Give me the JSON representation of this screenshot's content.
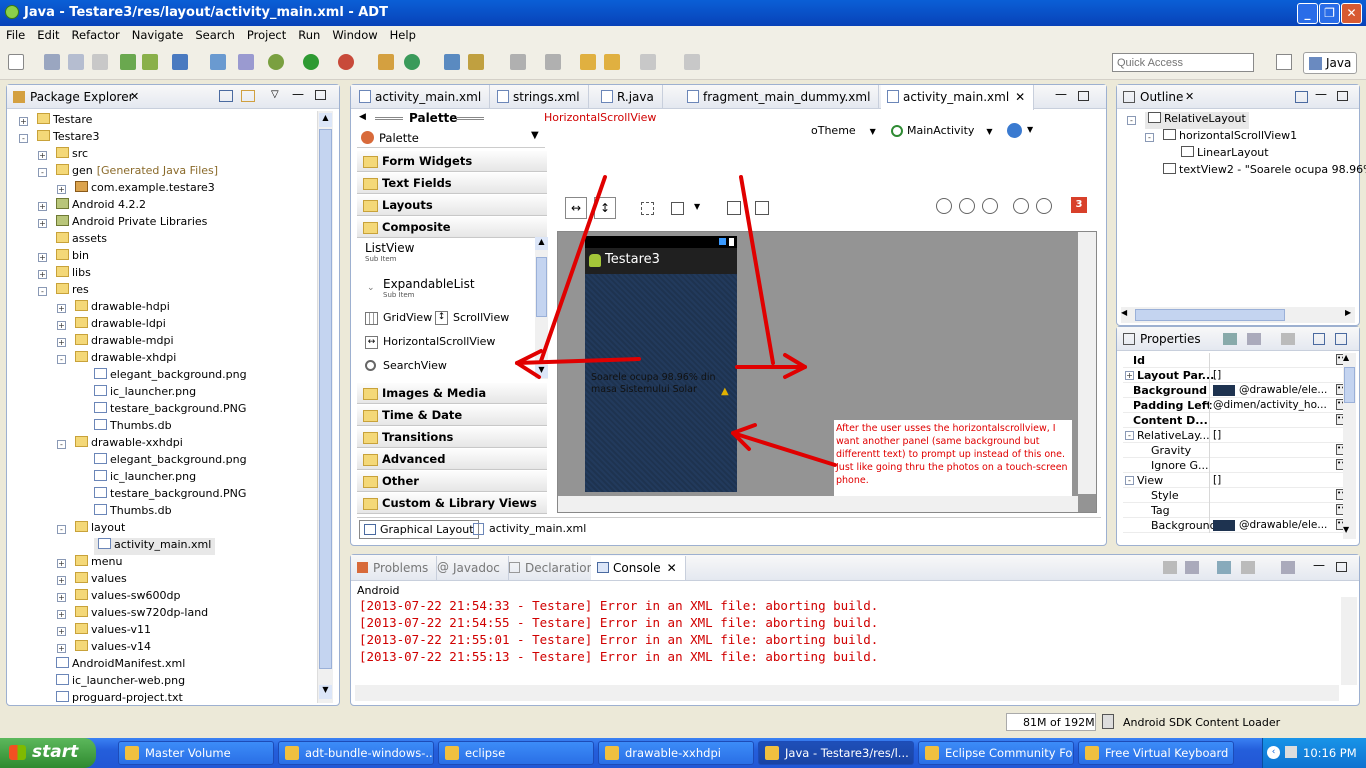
{
  "window": {
    "title": "Java - Testare3/res/layout/activity_main.xml - ADT"
  },
  "menu": [
    "File",
    "Edit",
    "Refactor",
    "Navigate",
    "Search",
    "Project",
    "Run",
    "Window",
    "Help"
  ],
  "quick_access": {
    "placeholder": "Quick Access"
  },
  "perspective": {
    "label": "Java"
  },
  "package_explorer": {
    "title": "Package Explorer",
    "items": [
      {
        "label": "Testare",
        "level": 0,
        "icon": "project",
        "toggle": "+"
      },
      {
        "label": "Testare3",
        "level": 0,
        "icon": "project",
        "toggle": "-"
      },
      {
        "label": "src",
        "level": 1,
        "icon": "folder",
        "toggle": "+"
      },
      {
        "label": "gen",
        "extra": "[Generated Java Files]",
        "level": 1,
        "icon": "folder",
        "toggle": "-"
      },
      {
        "label": "com.example.testare3",
        "level": 2,
        "icon": "package",
        "toggle": "+"
      },
      {
        "label": "Android 4.2.2",
        "level": 1,
        "icon": "library",
        "toggle": "+"
      },
      {
        "label": "Android Private Libraries",
        "level": 1,
        "icon": "library",
        "toggle": "+"
      },
      {
        "label": "assets",
        "level": 1,
        "icon": "folder",
        "toggle": ""
      },
      {
        "label": "bin",
        "level": 1,
        "icon": "folder",
        "toggle": "+"
      },
      {
        "label": "libs",
        "level": 1,
        "icon": "folder",
        "toggle": "+"
      },
      {
        "label": "res",
        "level": 1,
        "icon": "folder",
        "toggle": "-"
      },
      {
        "label": "drawable-hdpi",
        "level": 2,
        "icon": "folder",
        "toggle": "+"
      },
      {
        "label": "drawable-ldpi",
        "level": 2,
        "icon": "folder",
        "toggle": "+"
      },
      {
        "label": "drawable-mdpi",
        "level": 2,
        "icon": "folder",
        "toggle": "+"
      },
      {
        "label": "drawable-xhdpi",
        "level": 2,
        "icon": "folder",
        "toggle": "-"
      },
      {
        "label": "elegant_background.png",
        "level": 3,
        "icon": "file",
        "toggle": ""
      },
      {
        "label": "ic_launcher.png",
        "level": 3,
        "icon": "file",
        "toggle": ""
      },
      {
        "label": "testare_background.PNG",
        "level": 3,
        "icon": "file",
        "toggle": ""
      },
      {
        "label": "Thumbs.db",
        "level": 3,
        "icon": "file",
        "toggle": ""
      },
      {
        "label": "drawable-xxhdpi",
        "level": 2,
        "icon": "folder",
        "toggle": "-"
      },
      {
        "label": "elegant_background.png",
        "level": 3,
        "icon": "file",
        "toggle": ""
      },
      {
        "label": "ic_launcher.png",
        "level": 3,
        "icon": "file",
        "toggle": ""
      },
      {
        "label": "testare_background.PNG",
        "level": 3,
        "icon": "file",
        "toggle": ""
      },
      {
        "label": "Thumbs.db",
        "level": 3,
        "icon": "file",
        "toggle": ""
      },
      {
        "label": "layout",
        "level": 2,
        "icon": "folder",
        "toggle": "-"
      },
      {
        "label": "activity_main.xml",
        "level": 3,
        "icon": "file",
        "toggle": "",
        "selected": true
      },
      {
        "label": "menu",
        "level": 2,
        "icon": "folder",
        "toggle": "+"
      },
      {
        "label": "values",
        "level": 2,
        "icon": "folder",
        "toggle": "+"
      },
      {
        "label": "values-sw600dp",
        "level": 2,
        "icon": "folder",
        "toggle": "+"
      },
      {
        "label": "values-sw720dp-land",
        "level": 2,
        "icon": "folder",
        "toggle": "+"
      },
      {
        "label": "values-v11",
        "level": 2,
        "icon": "folder",
        "toggle": "+"
      },
      {
        "label": "values-v14",
        "level": 2,
        "icon": "folder",
        "toggle": "+"
      },
      {
        "label": "AndroidManifest.xml",
        "level": 1,
        "icon": "file",
        "toggle": ""
      },
      {
        "label": "ic_launcher-web.png",
        "level": 1,
        "icon": "file",
        "toggle": ""
      },
      {
        "label": "proguard-project.txt",
        "level": 1,
        "icon": "file",
        "toggle": ""
      }
    ]
  },
  "editor": {
    "tabs": [
      {
        "label": "activity_main.xml",
        "active": false
      },
      {
        "label": "strings.xml",
        "active": false
      },
      {
        "label": "R.java",
        "active": false
      },
      {
        "label": "fragment_main_dummy.xml",
        "active": false
      },
      {
        "label": "activity_main.xml",
        "active": true
      }
    ],
    "palette_title": "Palette",
    "palette_dropdown": "Palette",
    "breadcrumb": "HorizontalScrollView",
    "theme_label": "oTheme",
    "activity_label": "MainActivity",
    "categories_top": [
      "Form Widgets",
      "Text Fields",
      "Layouts",
      "Composite"
    ],
    "composite_items": [
      {
        "label": "ListView",
        "sub": "Sub Item"
      },
      {
        "label": "ExpandableList",
        "sub": "Sub Item"
      }
    ],
    "widget_grid": "GridView",
    "widget_scroll": "ScrollView",
    "widget_hscroll": "HorizontalScrollView",
    "widget_search": "SearchView",
    "categories_bottom": [
      "Images & Media",
      "Time & Date",
      "Transitions",
      "Advanced",
      "Other",
      "Custom & Library Views"
    ],
    "error_count": "3",
    "device": {
      "app_title": "Testare3",
      "text": "Soarele ocupa 98.96% din masa Sistemului Solar"
    },
    "annotation": "After the user usses the horizontalscrollview, I want another panel (same background but differentt text) to prompt up instead of this one. Just like going thru the photos on a touch-screen phone.",
    "bottom_tabs": [
      "Graphical Layout",
      "activity_main.xml"
    ]
  },
  "outline": {
    "title": "Outline",
    "items": [
      {
        "label": "RelativeLayout",
        "level": 0
      },
      {
        "label": "horizontalScrollView1",
        "level": 1
      },
      {
        "label": "LinearLayout",
        "level": 2
      },
      {
        "label": "textView2 - \"Soarele ocupa 98.96%",
        "level": 1
      }
    ]
  },
  "properties": {
    "title": "Properties",
    "rows": [
      {
        "name": "Id",
        "value": "",
        "bold": true
      },
      {
        "name": "Layout Par...",
        "value": "[]",
        "bold": true,
        "toggle": "+"
      },
      {
        "name": "Background",
        "value": "@drawable/ele...",
        "bold": true,
        "swatch": true
      },
      {
        "name": "Padding Left",
        "value": "@dimen/activity_ho...",
        "bold": true
      },
      {
        "name": "Content D...",
        "value": "",
        "bold": true
      },
      {
        "name": "RelativeLay...",
        "value": "[]",
        "bold": false,
        "toggle": "-"
      },
      {
        "name": "Gravity",
        "value": "",
        "bold": false,
        "indent": true
      },
      {
        "name": "Ignore G...",
        "value": "",
        "bold": false,
        "indent": true
      },
      {
        "name": "View",
        "value": "[]",
        "bold": false,
        "toggle": "-"
      },
      {
        "name": "Style",
        "value": "",
        "bold": false,
        "indent": true
      },
      {
        "name": "Tag",
        "value": "",
        "bold": false,
        "indent": true
      },
      {
        "name": "Background",
        "value": "@drawable/ele...",
        "bold": false,
        "indent": true,
        "swatch": true
      }
    ]
  },
  "console": {
    "tabs": [
      "Problems",
      "Javadoc",
      "Declaration",
      "Console"
    ],
    "label": "Android",
    "lines": [
      "[2013-07-22 21:54:33 - Testare] Error in an XML file: aborting build.",
      "[2013-07-22 21:54:55 - Testare] Error in an XML file: aborting build.",
      "[2013-07-22 21:55:01 - Testare] Error in an XML file: aborting build.",
      "[2013-07-22 21:55:13 - Testare] Error in an XML file: aborting build."
    ]
  },
  "status": {
    "memory": "81M of 192M",
    "loader": "Android SDK Content Loader"
  },
  "taskbar": {
    "start": "start",
    "items": [
      "Master Volume",
      "adt-bundle-windows-...",
      "eclipse",
      "drawable-xxhdpi",
      "Java - Testare3/res/l...",
      "Eclipse Community Fo...",
      "Free Virtual Keyboard"
    ],
    "clock": "10:16 PM"
  },
  "colors": {
    "titlebar": "#0a54d0",
    "annotation_red": "#e00000",
    "error_red": "#d00000",
    "taskbar": "#245edb"
  }
}
